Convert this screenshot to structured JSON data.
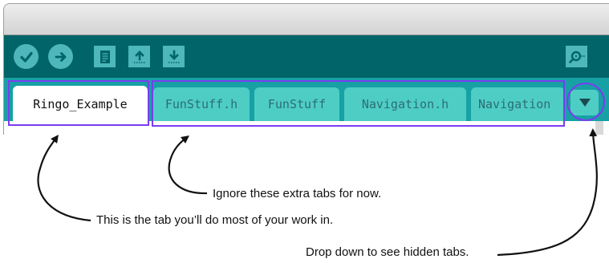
{
  "toolbar": {
    "buttons": [
      {
        "name": "verify-button",
        "icon": "checkmark-icon"
      },
      {
        "name": "upload-button",
        "icon": "right-arrow-icon"
      },
      {
        "name": "new-button",
        "icon": "document-icon"
      },
      {
        "name": "open-button",
        "icon": "up-arrow-icon"
      },
      {
        "name": "save-button",
        "icon": "down-arrow-icon"
      },
      {
        "name": "serial-monitor-button",
        "icon": "magnifier-icon"
      }
    ]
  },
  "tabs": [
    {
      "label": "Ringo_Example",
      "active": true
    },
    {
      "label": "FunStuff.h",
      "active": false
    },
    {
      "label": "FunStuff",
      "active": false
    },
    {
      "label": "Navigation.h",
      "active": false
    },
    {
      "label": "Navigation",
      "active": false
    }
  ],
  "tab_menu": {
    "icon": "triangle-down-icon"
  },
  "annotations": {
    "extra_tabs": "Ignore these extra tabs for now.",
    "main_tab": "This is the tab you’ll do most of your work in.",
    "dropdown": "Drop down to see hidden tabs."
  },
  "colors": {
    "toolbar": "#006468",
    "tabstrip": "#17a1a5",
    "tab": "#4ecdc4",
    "button": "#4db7bb",
    "highlight": "#7a3df0"
  }
}
